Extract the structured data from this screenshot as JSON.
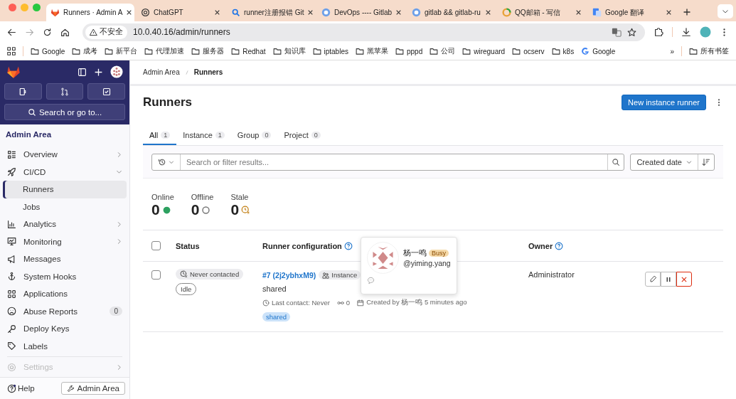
{
  "browser": {
    "tabs": [
      {
        "title": "Runners · Admin A",
        "kind": "gitlab",
        "selected": true
      },
      {
        "title": "ChatGPT",
        "kind": "chatgpt",
        "selected": false
      },
      {
        "title": "runner注册报错 Git",
        "kind": "search",
        "selected": false
      },
      {
        "title": "DevOps ---- Gitlab",
        "kind": "devops",
        "selected": false
      },
      {
        "title": "gitlab && gitlab-ru",
        "kind": "devops",
        "selected": false
      },
      {
        "title": "QQ邮箱 - 写信",
        "kind": "qq",
        "selected": false
      },
      {
        "title": "Google 翻译",
        "kind": "translate",
        "selected": false
      }
    ],
    "security_label": "不安全",
    "url": "10.0.40.16/admin/runners",
    "bookmarks": [
      {
        "label": "Google",
        "kind": "folder"
      },
      {
        "label": "成考",
        "kind": "folder"
      },
      {
        "label": "新平台",
        "kind": "folder"
      },
      {
        "label": "代理加速",
        "kind": "folder"
      },
      {
        "label": "服务器",
        "kind": "folder"
      },
      {
        "label": "Redhat",
        "kind": "folder"
      },
      {
        "label": "知识库",
        "kind": "folder"
      },
      {
        "label": "iptables",
        "kind": "folder"
      },
      {
        "label": "黑苹果",
        "kind": "folder"
      },
      {
        "label": "pppd",
        "kind": "folder"
      },
      {
        "label": "公司",
        "kind": "folder"
      },
      {
        "label": "wireguard",
        "kind": "folder"
      },
      {
        "label": "ocserv",
        "kind": "folder"
      },
      {
        "label": "k8s",
        "kind": "folder"
      },
      {
        "label": "Google",
        "kind": "google"
      }
    ],
    "bookmarks_overflow": "»",
    "all_bookmarks": "所有书签"
  },
  "sidebar": {
    "search_label": "Search or go to...",
    "section_title": "Admin Area",
    "items": [
      {
        "label": "Overview",
        "expanded": false,
        "selected": false
      },
      {
        "label": "CI/CD",
        "expanded": true,
        "selected": false,
        "children": [
          {
            "label": "Runners",
            "selected": true
          },
          {
            "label": "Jobs",
            "selected": false
          }
        ]
      },
      {
        "label": "Analytics",
        "expanded": false,
        "selected": false
      },
      {
        "label": "Monitoring",
        "expanded": false,
        "selected": false
      },
      {
        "label": "Messages",
        "selected": false
      },
      {
        "label": "System Hooks",
        "selected": false
      },
      {
        "label": "Applications",
        "selected": false
      },
      {
        "label": "Abuse Reports",
        "selected": false,
        "count": "0"
      },
      {
        "label": "Deploy Keys",
        "selected": false
      },
      {
        "label": "Labels",
        "selected": false
      },
      {
        "label": "Settings",
        "expanded": false,
        "selected": false,
        "disabled": true
      }
    ],
    "help_label": "Help",
    "admin_button": "Admin Area"
  },
  "main": {
    "breadcrumb": [
      "Admin Area",
      "Runners"
    ],
    "title": "Runners",
    "primary_button": "New instance runner",
    "tabs": [
      {
        "label": "All",
        "count": "1",
        "selected": true
      },
      {
        "label": "Instance",
        "count": "1",
        "selected": false
      },
      {
        "label": "Group",
        "count": "0",
        "selected": false
      },
      {
        "label": "Project",
        "count": "0",
        "selected": false
      }
    ],
    "search": {
      "placeholder": "Search or filter results..."
    },
    "sort": "Created date",
    "stats": [
      {
        "label": "Online",
        "value": "0",
        "kind": "online"
      },
      {
        "label": "Offline",
        "value": "0",
        "kind": "offline"
      },
      {
        "label": "Stale",
        "value": "0",
        "kind": "stale"
      }
    ],
    "table": {
      "select_all_checked": false,
      "columns": [
        {
          "label": "Status",
          "help": false
        },
        {
          "label": "Runner configuration",
          "help": true
        },
        {
          "label": "Owner",
          "help": true
        }
      ],
      "rows": [
        {
          "checked": false,
          "statuses": [
            {
              "label": "Never contacted",
              "kind": "never"
            },
            {
              "label": "Idle",
              "kind": "idle"
            }
          ],
          "runner": "#7 (2j2ybhxM9)",
          "type_badge": "Instance",
          "description": "shared",
          "last_contact": "Last contact: Never",
          "jobs": "0",
          "created": "Created by 杨一鸣 5 minutes ago",
          "tags": [
            "shared"
          ],
          "owner": "Administrator"
        }
      ]
    },
    "popover": {
      "name": "杨一鸣",
      "badge": "Busy",
      "username": "@yiming.yang"
    }
  }
}
